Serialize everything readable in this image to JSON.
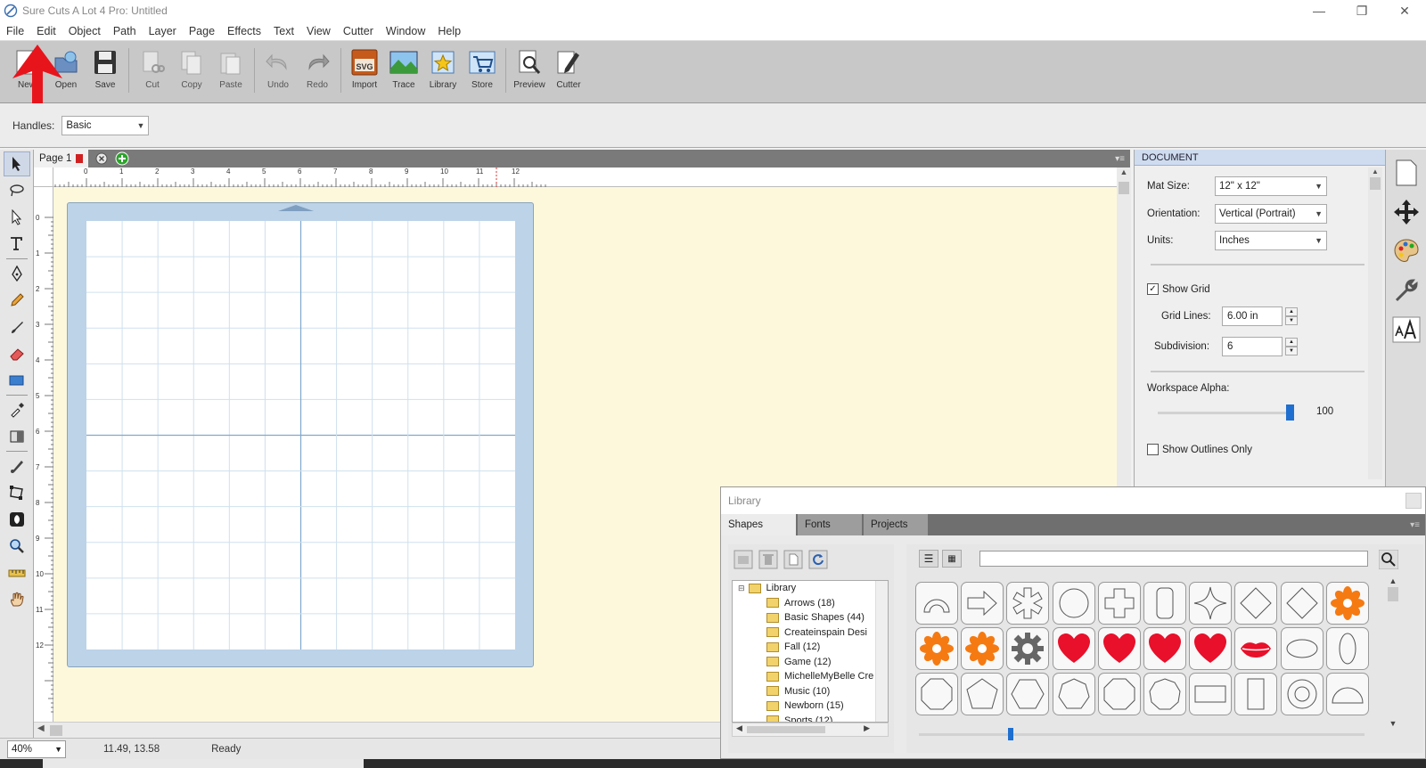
{
  "window": {
    "title": "Sure Cuts A Lot 4 Pro: Untitled",
    "minimize": "—",
    "maximize": "❐",
    "close": "✕"
  },
  "menu": [
    "File",
    "Edit",
    "Object",
    "Path",
    "Layer",
    "Page",
    "Effects",
    "Text",
    "View",
    "Cutter",
    "Window",
    "Help"
  ],
  "toolbar": {
    "new": "New",
    "open": "Open",
    "save": "Save",
    "cut": "Cut",
    "copy": "Copy",
    "paste": "Paste",
    "undo": "Undo",
    "redo": "Redo",
    "import": "Import",
    "import_badge": "SVG",
    "trace": "Trace",
    "library": "Library",
    "store": "Store",
    "preview": "Preview",
    "cutter": "Cutter"
  },
  "handles": {
    "label": "Handles:",
    "value": "Basic"
  },
  "page_tab": {
    "label": "Page 1"
  },
  "ruler_h": [
    "0",
    "1",
    "2",
    "3",
    "4",
    "5",
    "6",
    "7",
    "8",
    "9",
    "10",
    "11",
    "12"
  ],
  "ruler_v": [
    "0",
    "1",
    "2",
    "3",
    "4",
    "5",
    "6",
    "7",
    "8",
    "9",
    "10",
    "11",
    "12"
  ],
  "document": {
    "header": "DOCUMENT",
    "mat_size_label": "Mat Size:",
    "mat_size": "12\" x 12\"",
    "orientation_label": "Orientation:",
    "orientation": "Vertical (Portrait)",
    "units_label": "Units:",
    "units": "Inches",
    "show_grid_label": "Show Grid",
    "show_grid": true,
    "grid_lines_label": "Grid Lines:",
    "grid_lines": "6.00 in",
    "subdivision_label": "Subdivision:",
    "subdivision": "6",
    "workspace_alpha_label": "Workspace Alpha:",
    "workspace_alpha": "100",
    "show_outlines_label": "Show Outlines Only",
    "show_outlines": false
  },
  "library": {
    "title": "Library",
    "tabs": [
      "Shapes",
      "Fonts",
      "Projects"
    ],
    "tree_root": "Library",
    "folders": [
      "Arrows (18)",
      "Basic Shapes (44)",
      "Createinspain Desi",
      "Fall (12)",
      "Game (12)",
      "MichelleMyBelle Cre",
      "Music (10)",
      "Newborn (15)",
      "Sports (12)"
    ],
    "search_placeholder": "",
    "shapes_row1": [
      "arc",
      "arrow",
      "asterisk",
      "circle",
      "cross",
      "rounded-rect",
      "star4",
      "diamond",
      "diamond",
      "flower-orange"
    ],
    "shapes_row2": [
      "flower-orange",
      "flower-orange",
      "gear",
      "heart",
      "heart",
      "heart",
      "heart",
      "lips",
      "ellipse",
      "ellipse-vertical"
    ],
    "shapes_row3": [
      "octagon",
      "pentagon",
      "hexagon",
      "heptagon",
      "octagon",
      "nonagon",
      "rectangle",
      "tall-rect",
      "ring",
      "half-circle"
    ],
    "accent_red": "#e8102a",
    "accent_orange": "#f57a12"
  },
  "status": {
    "zoom": "40%",
    "coords": "11.49, 13.58",
    "state": "Ready"
  }
}
